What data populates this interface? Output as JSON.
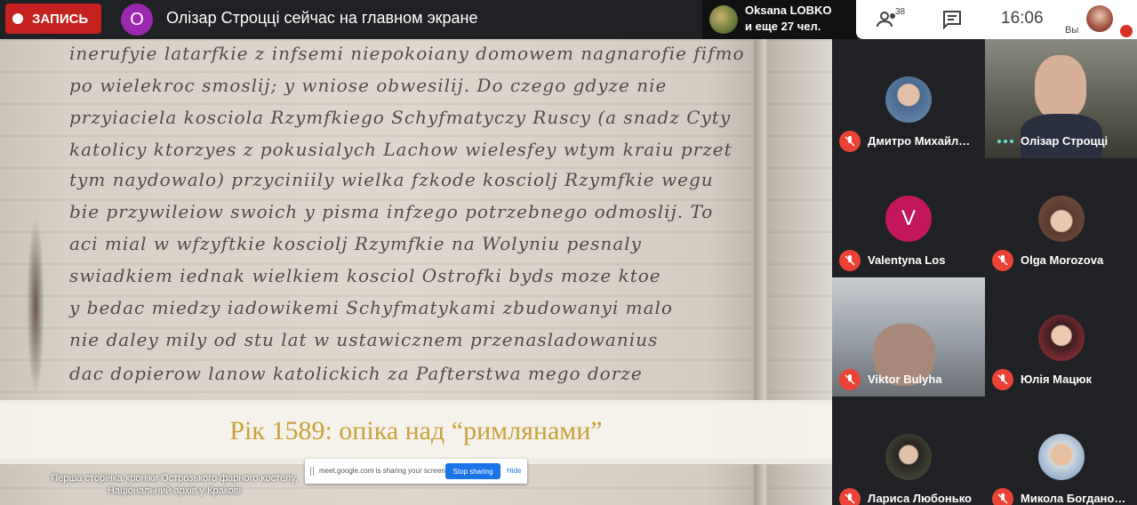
{
  "topbar": {
    "record_label": "ЗАПИСЬ",
    "presenter_initial": "О",
    "presenter_text": "Олізар Строцці сейчас на главном экране",
    "participant_name": "Oksana LOBKO",
    "participant_more": "и еще 27 чел.",
    "people_count": "38",
    "clock": "16:06",
    "you_label": "Вы"
  },
  "shared": {
    "manuscript_lines": [
      "inerufyie latarfkie z infsemi niepokoiany domowem nagnarofie fifmo",
      "po wielekroc smoslij; y wniose obwesilij. Do czego gdyze nie",
      "przyiaciela kosciola Rzymfkiego Schyfmatyczy Ruscy (a snadz Cyty",
      "katolicy ktorzyes z pokusialych Lachow wielesfey wtym kraiu przet",
      "tym naydowalo) przyciniily wielka fzkode kosciolj Rzymfkie wegu",
      "bie przywileiow swoich y pisma infzego potrzebnego odmoslij. To",
      "aci mial w wfzyftkie kosciolj Rzymfkie na Wolyniu pesnaly",
      "swiadkiem iednak wielkiem kosciol Ostrofki byds moze ktoe",
      "y bedac miedzy iadowikemi Schyfmatykami zbudowanyi malo",
      "nie daley mily od stu lat w ustawicznem przenasladowanius",
      "dac dopierow lanow katolickich za Pafterstwa mego dorze"
    ],
    "banner_title": "Рік 1589: опіка над “римлянами”",
    "caption": "Перша сторінка хроніки Острозького фарного костелу, Національний архів у Кракові",
    "sharebar": {
      "text": "meet.google.com is sharing your screen.",
      "stop_label": "Stop sharing",
      "hide_label": "Hide"
    }
  },
  "participants": [
    {
      "name": "Дмитро Михайл…",
      "muted": true,
      "avatar_color": "#6a8fb0"
    },
    {
      "name": "Олізар Строцці",
      "muted": false,
      "avatar_color": "#c8a080"
    },
    {
      "name": "Valentyna Los",
      "muted": true,
      "initial": "V",
      "avatar_color": "#c2185b"
    },
    {
      "name": "Olga Morozova",
      "muted": true,
      "avatar_color": "#7a5040"
    },
    {
      "name": "Viktor Bulyha",
      "muted": true,
      "avatar_color": "#8a8a8a"
    },
    {
      "name": "Юлія Мацюк",
      "muted": true,
      "avatar_color": "#b03040"
    },
    {
      "name": "Лариса Любонько",
      "muted": true,
      "avatar_color": "#4a5a40"
    },
    {
      "name": "Микола Богдано…",
      "muted": true,
      "avatar_color": "#6a90c0"
    }
  ]
}
